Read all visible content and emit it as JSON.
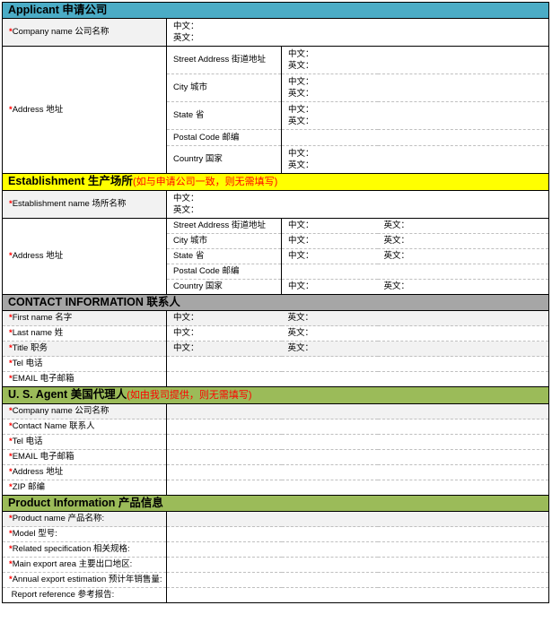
{
  "meta": {
    "cn_label": "中文：",
    "en_label": "英文："
  },
  "sections": {
    "applicant": {
      "header_en": "Applicant ",
      "header_cn": "申请公司",
      "color": "#4BACC6",
      "rows": {
        "company_name": {
          "label_en": "Company name ",
          "label_cn": "公司名称",
          "required": "*",
          "cn": "中文：",
          "en": "英文："
        },
        "address": {
          "label_en": "Address ",
          "label_cn": "地址",
          "required": "*",
          "fields": [
            {
              "en": "Street Address ",
              "cn": "街道地址",
              "v_cn": "中文：",
              "v_en": "英文："
            },
            {
              "en": "City ",
              "cn": "城市",
              "v_cn": "中文：",
              "v_en": "英文："
            },
            {
              "en": "State ",
              "cn": "省",
              "v_cn": "中文：",
              "v_en": "英文："
            },
            {
              "en": "Postal Code ",
              "cn": "邮编",
              "v_cn": "",
              "v_en": ""
            },
            {
              "en": "Country ",
              "cn": "国家",
              "v_cn": "中文：",
              "v_en": "英文："
            }
          ]
        }
      }
    },
    "establishment": {
      "header_en": "Establishment ",
      "header_cn": "生产场所",
      "header_note": "(如与申请公司一致，则无需填写)",
      "color": "#ffff00",
      "rows": {
        "establishment_name": {
          "label_en": "Establishment name ",
          "label_cn": "场所名称",
          "required": "*",
          "cn": "中文：",
          "en": "英文："
        },
        "address": {
          "label_en": "Address ",
          "label_cn": "地址",
          "required": "*",
          "fields": [
            {
              "en": "Street Address ",
              "cn": "街道地址",
              "v_cn": "中文：",
              "v_en": "英文："
            },
            {
              "en": "City ",
              "cn": "城市",
              "v_cn": "中文：",
              "v_en": "英文："
            },
            {
              "en": "State ",
              "cn": "省",
              "v_cn": "中文：",
              "v_en": "英文："
            },
            {
              "en": "Postal Code ",
              "cn": "邮编",
              "v_cn": "",
              "v_en": ""
            },
            {
              "en": "Country ",
              "cn": "国家",
              "v_cn": "中文：",
              "v_en": "英文："
            }
          ]
        }
      }
    },
    "contact": {
      "header_en": "CONTACT INFORMATION ",
      "header_cn": "联系人",
      "color": "#A6A6A6",
      "rows": [
        {
          "label_en": "First name ",
          "label_cn": "名字",
          "required": "*",
          "v_cn": "中文：",
          "v_en": "英文："
        },
        {
          "label_en": "Last name ",
          "label_cn": "姓",
          "required": "*",
          "v_cn": "中文：",
          "v_en": "英文："
        },
        {
          "label_en": "Title ",
          "label_cn": "职务",
          "required": "*",
          "v_cn": "中文：",
          "v_en": "英文："
        },
        {
          "label_en": "Tel ",
          "label_cn": "电话",
          "required": "*",
          "v_cn": "",
          "v_en": ""
        },
        {
          "label_en": "EMAIL ",
          "label_cn": "电子邮箱",
          "required": "*",
          "v_cn": "",
          "v_en": ""
        }
      ]
    },
    "us_agent": {
      "header_en": "U. S. Agent ",
      "header_cn": "美国代理人",
      "header_note": "(如由我司提供，则无需填写)",
      "color": "#9BBB59",
      "rows": [
        {
          "label_en": "Company name ",
          "label_cn": "公司名称",
          "required": "*",
          "value": ""
        },
        {
          "label_en": "Contact Name ",
          "label_cn": "联系人",
          "required": "*",
          "value": ""
        },
        {
          "label_en": "Tel ",
          "label_cn": "电话",
          "required": "*",
          "value": ""
        },
        {
          "label_en": "EMAIL ",
          "label_cn": "电子邮箱",
          "required": "*",
          "value": ""
        },
        {
          "label_en": "Address ",
          "label_cn": "地址",
          "required": "*",
          "value": ""
        },
        {
          "label_en": "ZIP ",
          "label_cn": "邮编",
          "required": "*",
          "value": ""
        }
      ]
    },
    "product": {
      "header_en": "Product Information ",
      "header_cn": "产品信息",
      "color": "#9BBB59",
      "rows": [
        {
          "label_en": "Product name ",
          "label_cn": "产品名称:",
          "required": "*",
          "value": ""
        },
        {
          "label_en": "Model ",
          "label_cn": "型号:",
          "required": "*",
          "value": ""
        },
        {
          "label_en": "Related specification ",
          "label_cn": "相关规格:",
          "required": "*",
          "value": ""
        },
        {
          "label_en": "Main export area ",
          "label_cn": "主要出口地区:",
          "required": "*",
          "value": ""
        },
        {
          "label_en": "Annual export estimation ",
          "label_cn": "预计年销售量:",
          "required": "*",
          "value": ""
        },
        {
          "label_en": "Report reference ",
          "label_cn": "参考报告:",
          "required": "",
          "value": ""
        }
      ]
    }
  }
}
